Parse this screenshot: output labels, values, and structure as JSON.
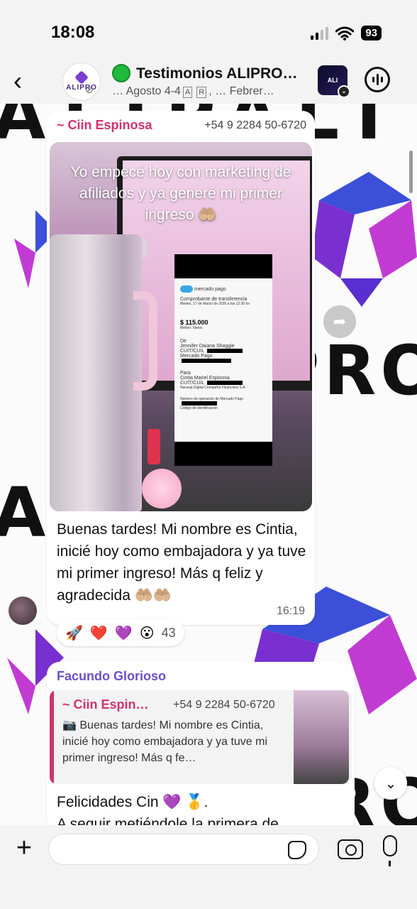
{
  "status_bar": {
    "time": "18:08",
    "battery": "93",
    "icons": [
      "signal-icon",
      "wifi-icon",
      "battery-icon"
    ]
  },
  "header": {
    "back_icon": "back-chevron-icon",
    "avatar_text": "ALIPRO",
    "title": "Testimonios ALIPRO…",
    "subtitle_prefix": "… Agosto 4-4",
    "subtitle_badge_a": "A",
    "subtitle_badge_r": "R",
    "subtitle_suffix": ", … Febrer…",
    "community_logo_text": "ALI",
    "voice_icon": "voice-chat-icon"
  },
  "messages": {
    "first": {
      "sender": "~ Ciin Espinosa",
      "phone": "+54 9 2284 50-6720",
      "photo_caption": "Yo empecé hoy con marketing de afiliados y ya generé mi primer ingreso 🤲🏼",
      "receipt": {
        "brand": "mercado pago",
        "title": "Comprobante de transferencia",
        "date": "Martes, 17 de Marzo de 2026 a las 12:30 hs",
        "amount": "$ 115.000",
        "amount_label": "Motivo: Varios",
        "from_label": "De",
        "from_name": "Jennifer Daiana Shaggie",
        "from_bank": "Mercado Pago",
        "to_label": "Para",
        "to_name": "Cintia Mariel Espinosa",
        "to_bank": "Naranja Digital Compañía Financiera S.A.",
        "op_label": "Número de operación de Mercado Pago",
        "code_label": "Código de identificación"
      },
      "text": "Buenas tardes! Mi nombre es Cintia, inicié hoy como embajadora y ya tuve mi primer ingreso! Más q feliz y agradecida 🤲🏼🤲🏼",
      "time": "16:19",
      "reactions": [
        "🚀",
        "❤️",
        "💜",
        "😮"
      ],
      "reaction_count": "43"
    },
    "second": {
      "sender": "Facundo Glorioso",
      "quote_sender": "~ Ciin Espin…",
      "quote_phone": "+54 9 2284 50-6720",
      "quote_text": "📷 Buenas tardes! Mi nombre es Cintia, inicié hoy como embajadora y ya tuve mi primer ingreso! Más q fe…",
      "text_line1": "Felicidades Cin 💜 🥇.",
      "text_line2": "A seguir metiéndole la primera de"
    }
  },
  "wallpaper": {
    "row1": "ALIPALI",
    "row2": "PRO",
    "row3": "ALI",
    "row4": "PRO",
    "colors": {
      "purple": "#7a2fd1",
      "magenta": "#c13bd3",
      "blue": "#3b4fd9"
    }
  },
  "input_bar": {
    "placeholder": "",
    "plus_icon": "plus-icon",
    "sticker_icon": "sticker-icon",
    "camera_icon": "camera-icon",
    "mic_icon": "microphone-icon"
  },
  "colors": {
    "sender_pink": "#d0336b",
    "sender_purple": "#6b4fc7",
    "online_green": "#1fb93c"
  }
}
